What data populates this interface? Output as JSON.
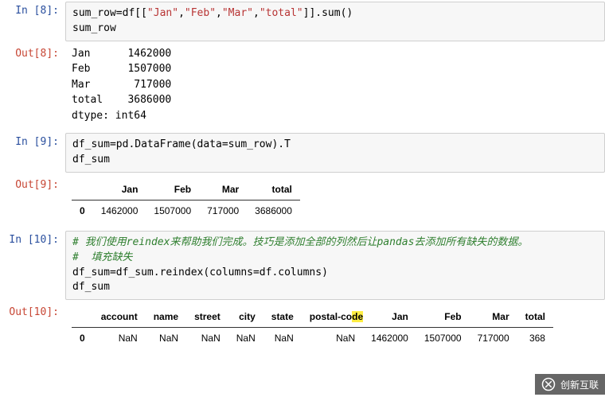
{
  "cells": {
    "in8": {
      "prompt": "In  [8]:",
      "line1a": "sum_row=df[[",
      "line1_s1": "\"Jan\"",
      "line1_c1": ",",
      "line1_s2": "\"Feb\"",
      "line1_c2": ",",
      "line1_s3": "\"Mar\"",
      "line1_c3": ",",
      "line1_s4": "\"total\"",
      "line1b": "]].sum()",
      "line2": "sum_row"
    },
    "out8": {
      "prompt": "Out[8]:",
      "text": "Jan      1462000\nFeb      1507000\nMar       717000\ntotal    3686000\ndtype: int64"
    },
    "in9": {
      "prompt": "In  [9]:",
      "line1": "df_sum=pd.DataFrame(data=sum_row).T",
      "line2": "df_sum"
    },
    "out9": {
      "prompt": "Out[9]:",
      "headers": [
        "Jan",
        "Feb",
        "Mar",
        "total"
      ],
      "index": "0",
      "row": [
        "1462000",
        "1507000",
        "717000",
        "3686000"
      ]
    },
    "in10": {
      "prompt": "In [10]:",
      "c1": "# 我们使用reindex来帮助我们完成。技巧是添加全部的列然后让pandas去添加所有缺失的数据。",
      "c2": "#  填充缺失",
      "l3": "df_sum=df_sum.reindex(columns=df.columns)",
      "l4": "df_sum"
    },
    "out10": {
      "prompt": "Out[10]:",
      "headers": [
        "account",
        "name",
        "street",
        "city",
        "state",
        "postal-co",
        "de",
        "Jan",
        "Feb",
        "Mar",
        "total"
      ],
      "index": "0",
      "row": [
        "NaN",
        "NaN",
        "NaN",
        "NaN",
        "NaN",
        "NaN",
        "1462000",
        "1507000",
        "717000",
        "368"
      ]
    }
  },
  "watermark": "创新互联"
}
